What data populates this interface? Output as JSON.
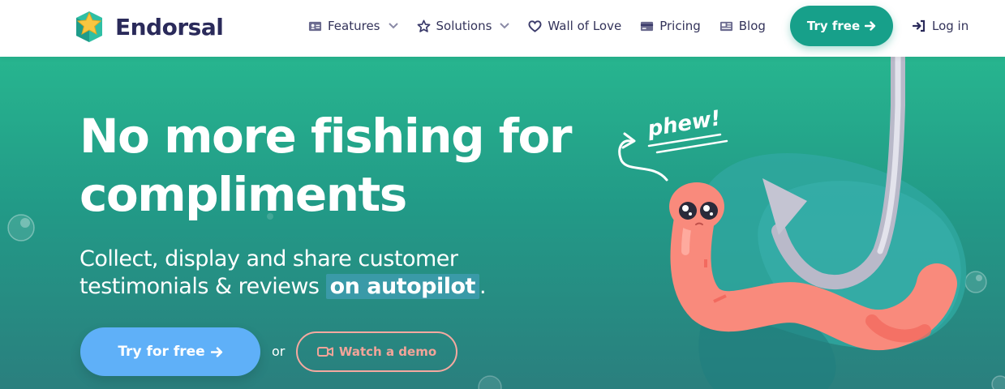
{
  "brand": {
    "name": "Endorsal",
    "logo_icon": "star-box-icon"
  },
  "nav": {
    "items": [
      {
        "label": "Features",
        "icon": "id-card-icon",
        "dropdown": true
      },
      {
        "label": "Solutions",
        "icon": "star-icon",
        "dropdown": true
      },
      {
        "label": "Wall of Love",
        "icon": "heart-icon",
        "dropdown": false
      },
      {
        "label": "Pricing",
        "icon": "credit-card-icon",
        "dropdown": false
      },
      {
        "label": "Blog",
        "icon": "newspaper-icon",
        "dropdown": false
      }
    ],
    "cta_label": "Try free",
    "login_label": "Log in"
  },
  "hero": {
    "headline_line1": "No more fishing for",
    "headline_line2": "compliments",
    "sub_line1": "Collect, display and share customer",
    "sub_line2_prefix": "testimonials & reviews ",
    "sub_highlight": "on autopilot",
    "sub_suffix": ".",
    "primary_cta": "Try for free",
    "or_text": "or",
    "secondary_cta": "Watch a demo",
    "illustration_text": "phew!"
  },
  "colors": {
    "brand_dark": "#2a2a5a",
    "teal": "#17a08a",
    "blue_button": "#5fb0f8",
    "coral": "#f3a499",
    "worm": "#fa8a7c"
  }
}
